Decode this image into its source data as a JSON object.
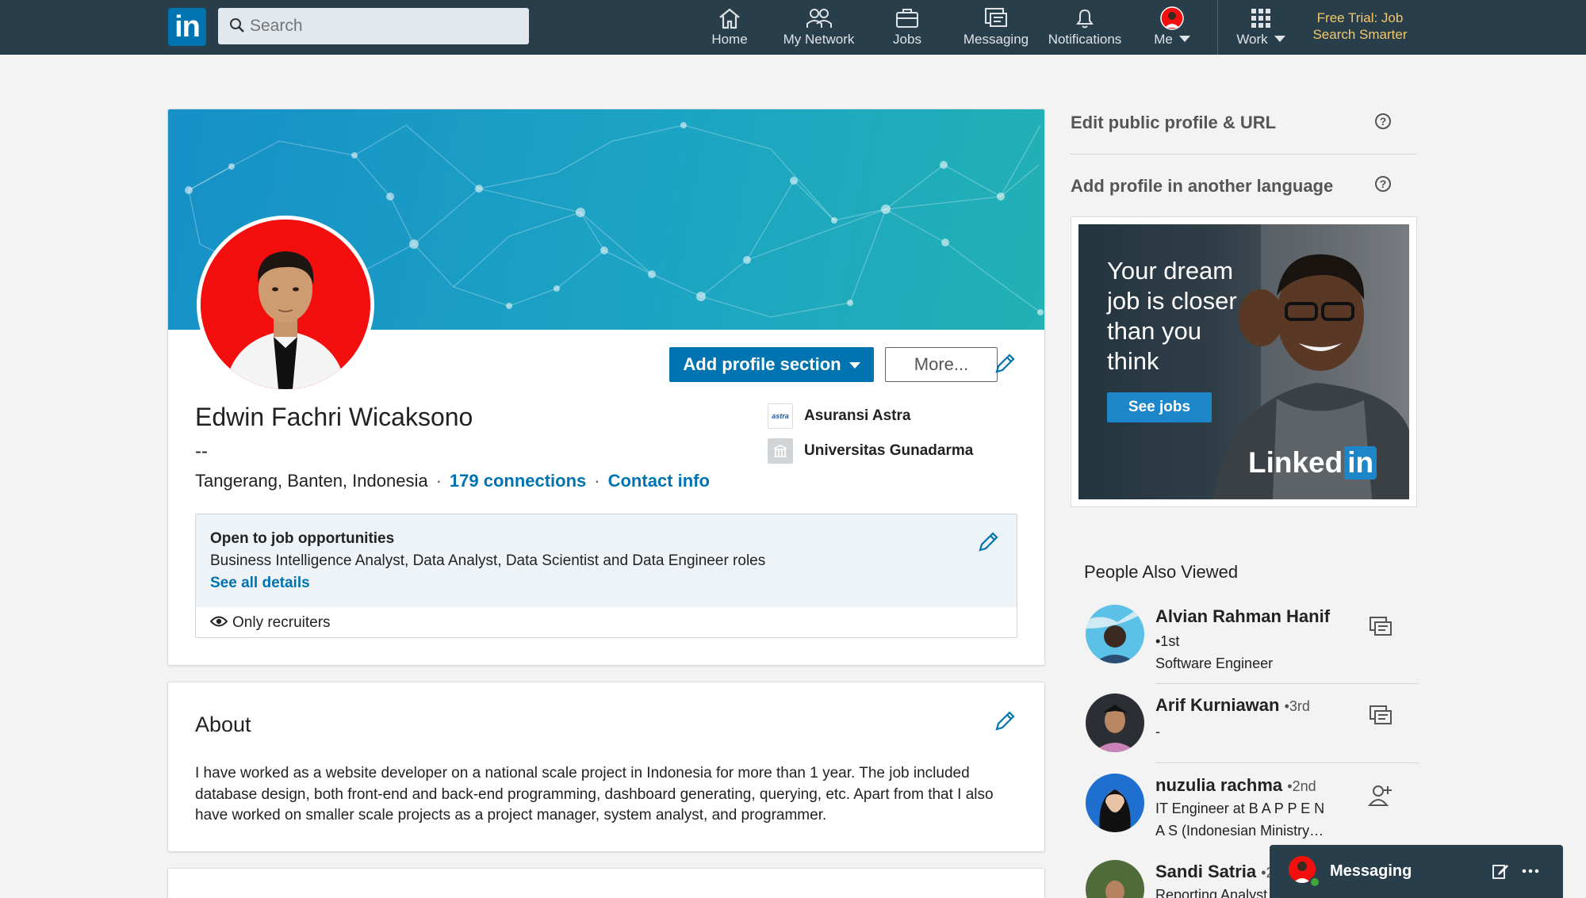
{
  "nav": {
    "logo": "in",
    "search_placeholder": "Search",
    "items": [
      {
        "label": "Home",
        "icon": "home-icon"
      },
      {
        "label": "My Network",
        "icon": "network-icon"
      },
      {
        "label": "Jobs",
        "icon": "briefcase-icon"
      },
      {
        "label": "Messaging",
        "icon": "messaging-icon"
      },
      {
        "label": "Notifications",
        "icon": "bell-icon"
      },
      {
        "label": "Me",
        "icon": "avatar"
      },
      {
        "label": "Work",
        "icon": "grid-icon"
      }
    ],
    "trial": "Free Trial: Job Search Smarter"
  },
  "profile": {
    "add_section_label": "Add profile section",
    "more_label": "More...",
    "name": "Edwin Fachri Wicaksono",
    "headline": "--",
    "location": "Tangerang, Banten, Indonesia",
    "connections": "179 connections",
    "contact": "Contact info",
    "company": "Asuransi Astra",
    "company_logo_text": "astra",
    "school": "Universitas Gunadarma",
    "job": {
      "title": "Open to job opportunities",
      "roles": "Business Intelligence Analyst, Data Analyst, Data Scientist and Data Engineer roles",
      "details_link": "See all details",
      "visibility": "Only recruiters"
    }
  },
  "about": {
    "title": "About",
    "text": "I have worked as a website developer on a national scale project in Indonesia for more than 1 year. The job included database design, both front-end and back-end programming, dashboard generating, querying, etc. Apart from that I also have worked on smaller scale projects as a project manager, system analyst, and programmer."
  },
  "rail": {
    "edit_public": "Edit public profile & URL",
    "add_language": "Add profile in another language",
    "ad": {
      "text": "Your dream job is closer than you think",
      "button": "See jobs",
      "brand": "Linked",
      "brand_in": "in"
    },
    "people_title": "People Also Viewed",
    "people": [
      {
        "name": "Alvian Rahman Hanif",
        "degree": "•1st",
        "line1": "Software Engineer",
        "line2": "",
        "action": "message-icon"
      },
      {
        "name": "Arif Kurniawan",
        "degree": "•3rd",
        "line1": "-",
        "line2": "",
        "action": "message-icon"
      },
      {
        "name": "nuzulia rachma",
        "degree": "•2nd",
        "line1": "IT Engineer at B A P P E N",
        "line2": "A S (Indonesian Ministry…",
        "action": "add-connection-icon"
      },
      {
        "name": "Sandi Satria",
        "degree": "•2",
        "line1": "Reporting Analyst",
        "line2": "",
        "action": ""
      }
    ]
  },
  "messaging": {
    "label": "Messaging"
  },
  "colors": {
    "nav_bg": "#283e4a",
    "brand_blue": "#0073b1",
    "trial_gold": "#f5c76b",
    "page_bg": "#f3f3f3"
  }
}
